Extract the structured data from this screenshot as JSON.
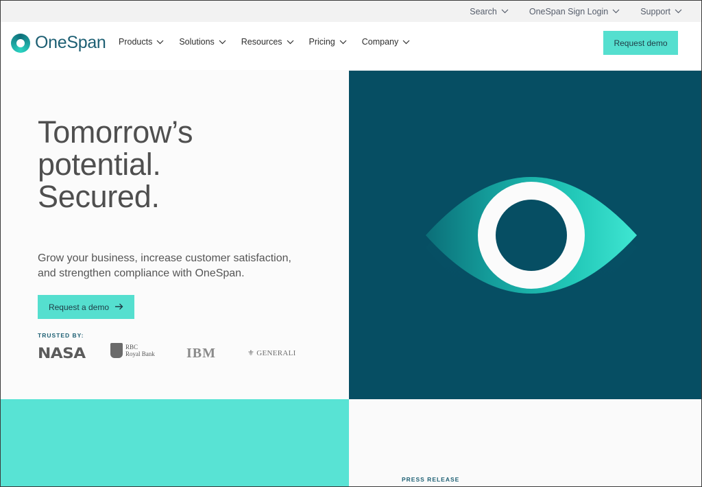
{
  "utility_bar": {
    "items": [
      {
        "label": "Search"
      },
      {
        "label": "OneSpan Sign Login"
      },
      {
        "label": "Support"
      }
    ]
  },
  "brand": {
    "name": "OneSpan"
  },
  "nav": {
    "items": [
      {
        "label": "Products"
      },
      {
        "label": "Solutions"
      },
      {
        "label": "Resources"
      },
      {
        "label": "Pricing"
      },
      {
        "label": "Company"
      }
    ],
    "cta_label": "Request demo"
  },
  "hero": {
    "title_lines": [
      "Tomorrow’s",
      "potential.",
      "Secured."
    ],
    "subtitle_lines": [
      "Grow your business, increase customer satisfaction,",
      "and strengthen compliance with OneSpan."
    ],
    "cta_label": "Request a demo",
    "trusted_label": "TRUSTED BY:",
    "logos": {
      "nasa": "NASA",
      "rbc_line1": "RBC",
      "rbc_line2": "Royal Bank",
      "ibm": "IBM",
      "generali": "GENERALI"
    }
  },
  "press": {
    "label": "PRESS RELEASE"
  },
  "colors": {
    "accent": "#55dfcf",
    "hero_panel": "#064e63",
    "brand_text": "#1d5f73"
  }
}
